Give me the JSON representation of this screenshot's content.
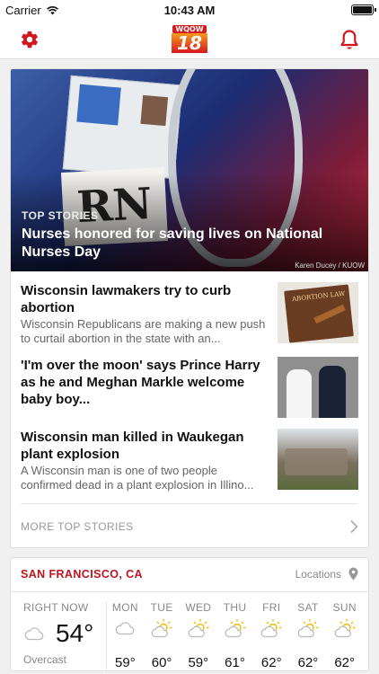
{
  "status_bar": {
    "carrier": "Carrier",
    "time": "10:43 AM"
  },
  "header": {
    "logo_text": "WQOW",
    "logo_number": "18"
  },
  "hero": {
    "kicker": "TOP STORIES",
    "headline": "Nurses honored for saving lives on National Nurses Day",
    "credit": "Karen Ducey / KUOW",
    "image_text": "RN"
  },
  "stories": [
    {
      "title": "Wisconsin lawmakers try to curb abortion",
      "summary": "Wisconsin Republicans are making a new push to curtail abortion in the state with an...",
      "thumb_text": "ABORTION LAW"
    },
    {
      "title": "'I'm over the moon' says Prince Harry as he and Meghan Markle welcome baby boy...",
      "summary": ""
    },
    {
      "title": "Wisconsin man killed in Waukegan plant explosion",
      "summary": "A Wisconsin man is one of two people confirmed dead in a plant explosion in Illino..."
    }
  ],
  "more_label": "MORE TOP STORIES",
  "weather": {
    "city": "SAN FRANCISCO, CA",
    "locations_label": "Locations",
    "now": {
      "label": "RIGHT NOW",
      "temp": "54°",
      "condition": "Overcast"
    },
    "forecast": [
      {
        "day": "MON",
        "icon": "cloud-icon",
        "high": "59°"
      },
      {
        "day": "TUE",
        "icon": "partly-sunny-icon",
        "high": "60°"
      },
      {
        "day": "WED",
        "icon": "partly-sunny-icon",
        "high": "59°"
      },
      {
        "day": "THU",
        "icon": "partly-sunny-icon",
        "high": "61°"
      },
      {
        "day": "FRI",
        "icon": "partly-sunny-icon",
        "high": "62°"
      },
      {
        "day": "SAT",
        "icon": "partly-sunny-icon",
        "high": "62°"
      },
      {
        "day": "SUN",
        "icon": "partly-sunny-icon",
        "high": "62°"
      }
    ]
  },
  "colors": {
    "accent": "#c1121f",
    "icon_red": "#d0161e"
  }
}
